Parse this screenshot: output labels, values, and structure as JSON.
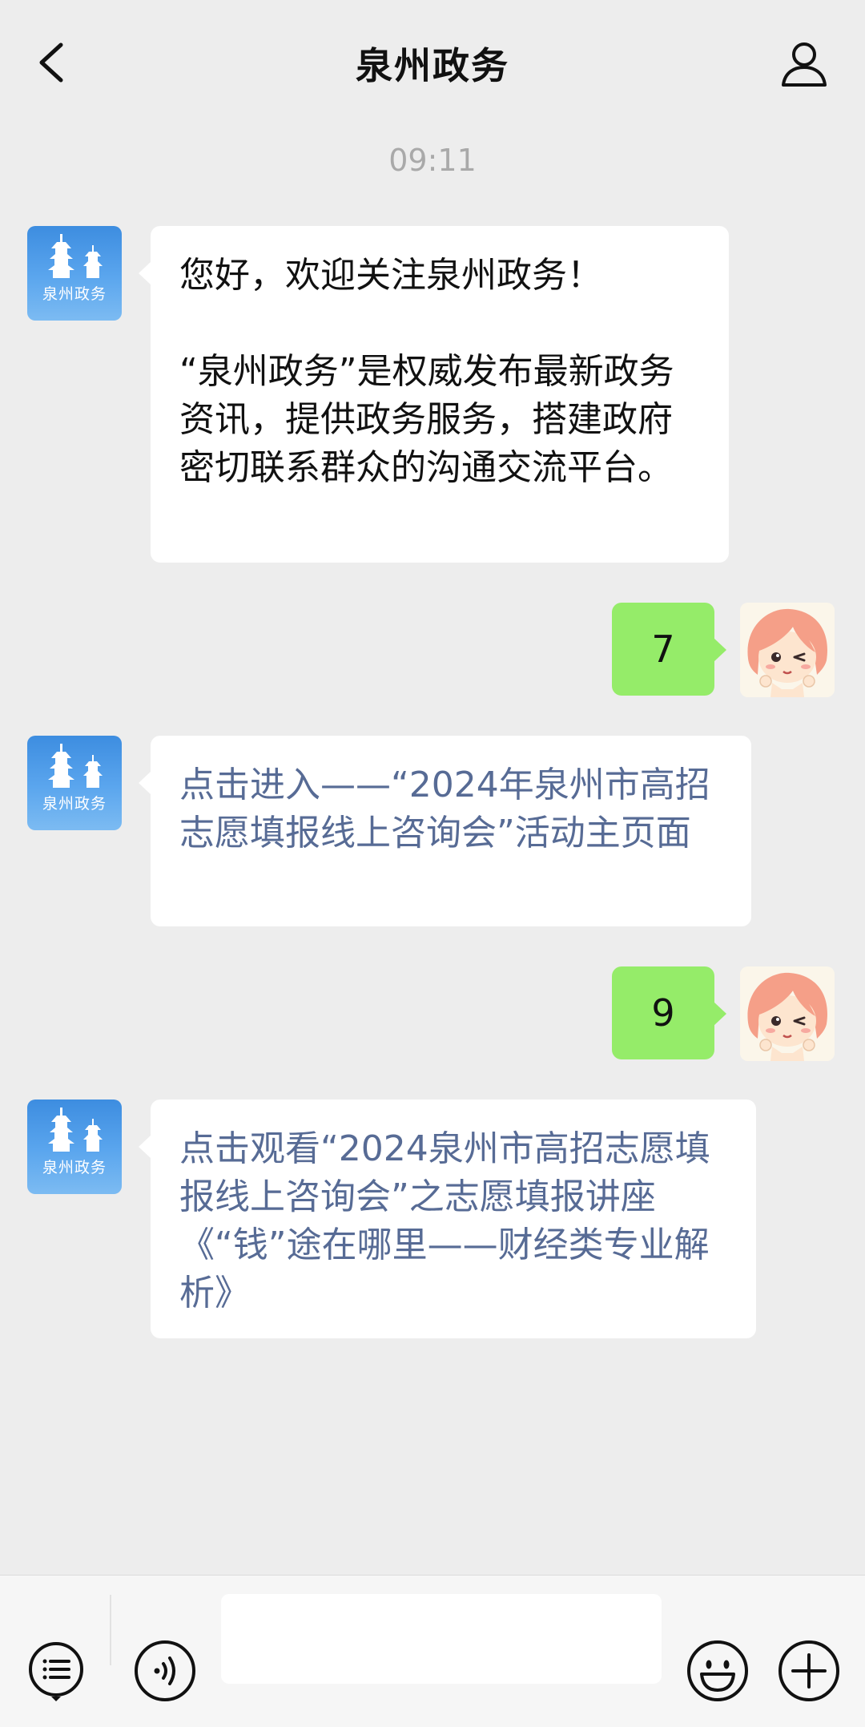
{
  "header": {
    "title": "泉州政务"
  },
  "timestamp": "09:11",
  "official": {
    "avatar_text": "泉州政务"
  },
  "messages": [
    {
      "from": "official",
      "paragraphs": [
        "您好，欢迎关注泉州政务！",
        "“泉州政务”是权威发布最新政务资讯，提供政务服务，搭建政府密切联系群众的沟通交流平台。"
      ]
    },
    {
      "from": "user",
      "text": "7"
    },
    {
      "from": "official",
      "link": "点击进入——“2024年泉州市高招志愿填报线上咨询会”活动主页面"
    },
    {
      "from": "user",
      "text": "9"
    },
    {
      "from": "official",
      "link": "点击观看“2024泉州市高招志愿填报线上咨询会”之志愿填报讲座《“钱”途在哪里——财经类专业解析》"
    }
  ],
  "bottom_bar": {
    "input_value": "",
    "icons": [
      "menu-list-icon",
      "voice-icon",
      "emoji-icon",
      "plus-icon"
    ]
  },
  "colors": {
    "background": "#ededed",
    "user_bubble": "#95ec69",
    "link": "#576b95",
    "timestamp": "#a9a9a9"
  }
}
